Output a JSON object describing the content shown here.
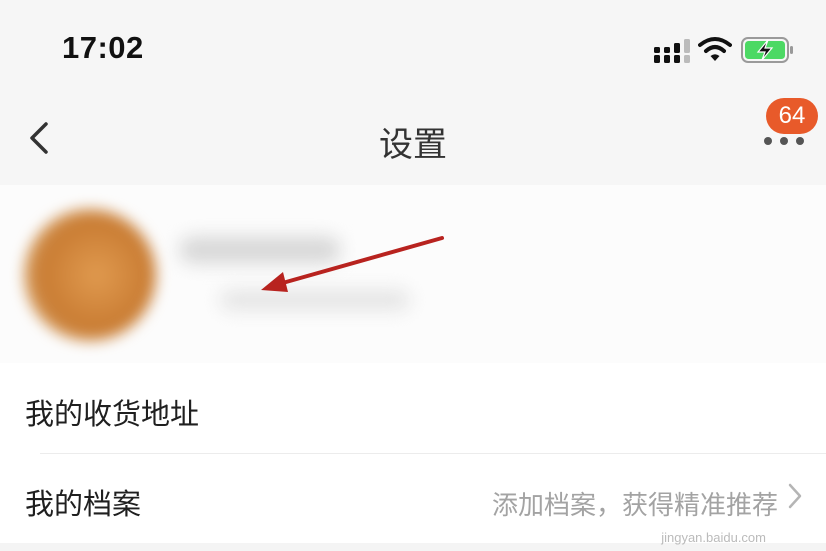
{
  "status_bar": {
    "time": "17:02",
    "signal_icon": "cellular-signal-icon",
    "wifi_icon": "wifi-icon",
    "battery_icon": "battery-charging-icon",
    "battery_color": "#4cd964"
  },
  "nav": {
    "title": "设置",
    "back_icon": "chevron-left-icon",
    "more_icon": "more-dots-icon",
    "badge_count": "64",
    "badge_color": "#e85a2a"
  },
  "profile": {
    "avatar": "blurred-avatar",
    "annotation": "red-arrow-pointing-to-avatar",
    "annotation_color": "#b8231f"
  },
  "settings": [
    {
      "label": "我的收货地址",
      "hint": ""
    },
    {
      "label": "我的档案",
      "hint": "添加档案，获得精准推荐"
    }
  ],
  "watermark": "jingyan.baidu.com"
}
